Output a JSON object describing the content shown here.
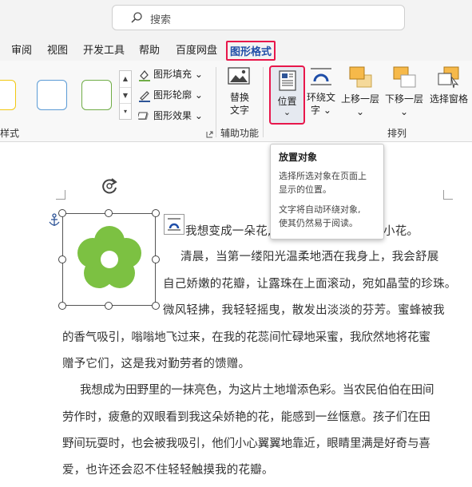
{
  "search": {
    "placeholder": "搜索",
    "icon": "search-icon"
  },
  "menu": {
    "items": [
      "审阅",
      "视图",
      "开发工具",
      "帮助",
      "百度网盘"
    ],
    "active": "图形格式"
  },
  "ribbon": {
    "style_group_label": "样式",
    "fill_label": "图形填充",
    "outline_label": "图形轮廓",
    "effect_label": "图形效果",
    "alt_text_label_1": "替换",
    "alt_text_label_2": "文字",
    "accessibility_group_label": "辅助功能",
    "position_label": "位置",
    "wrap_text_label_1": "环绕文",
    "wrap_text_label_2": "字",
    "bring_forward_label": "上移一层",
    "send_backward_label": "下移一层",
    "selection_pane_label": "选择窗格",
    "arrange_group_label": "排列",
    "swatch_colors": [
      "#f2c811",
      "#5b9bd5",
      "#70ad47"
    ],
    "accent_color": "#e8174b"
  },
  "tooltip": {
    "title": "放置对象",
    "line1": "选择所选对象在页面上",
    "line2": "显示的位置。",
    "line3": "文字将自动环绕对象,",
    "line4": "使其仍然易于阅读。"
  },
  "document": {
    "lines": [
      "我想变成一朵花,",
      "小花。",
      "清晨，当第一缕阳光温柔地洒在我身上，我会舒展",
      "自己娇嫩的花瓣，让露珠在上面滚动，宛如晶莹的珍珠。",
      "微风轻拂，我轻轻摇曳，散发出淡淡的芬芳。蜜蜂被我",
      "的香气吸引，嗡嗡地飞过来，在我的花蕊间忙碌地采蜜，我欣然地将花蜜",
      "赠予它们，这是我对勤劳者的馈赠。",
      "我想成为田野里的一抹亮色，为这片土地增添色彩。当农民伯伯在田间",
      "劳作时，疲惫的双眼看到我这朵娇艳的花，能感到一丝惬意。孩子们在田",
      "野间玩耍时，也会被我吸引，他们小心翼翼地靠近，眼睛里满是好奇与喜",
      "爱，也许还会忍不住轻轻触摸我的花瓣。"
    ]
  },
  "shape": {
    "flower_color": "#7cc142"
  }
}
